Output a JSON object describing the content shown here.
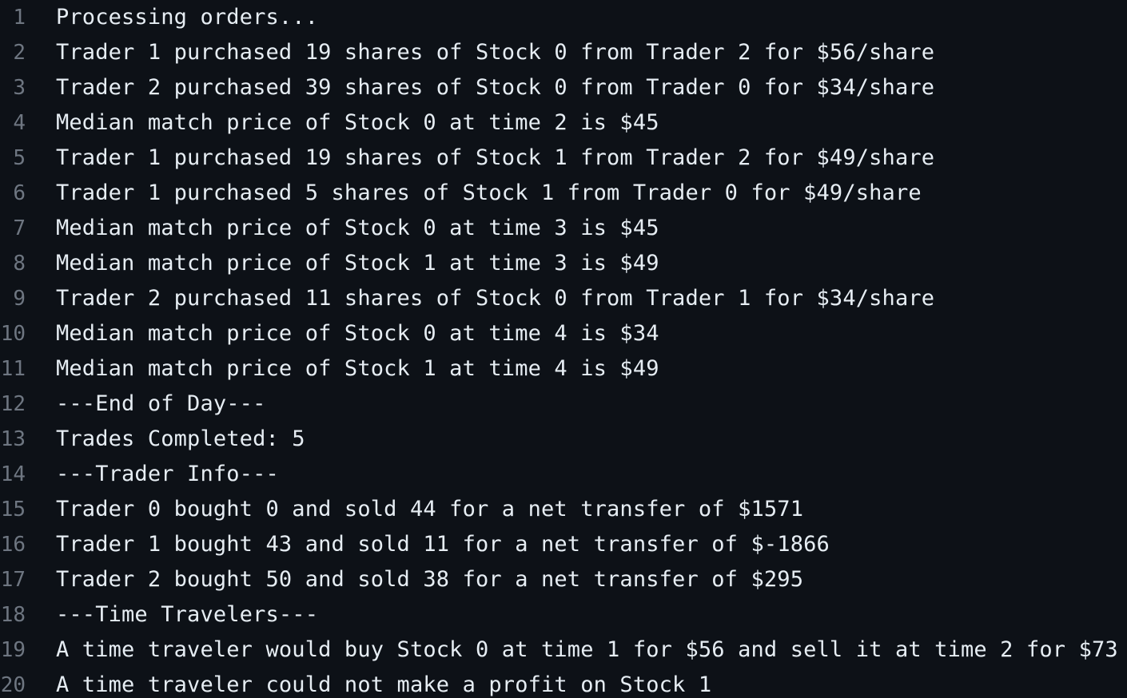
{
  "theme": {
    "background": "#0d1117",
    "text": "#e6edf3",
    "line_number": "#6e7681"
  },
  "lines": [
    {
      "n": "1",
      "text": "Processing orders..."
    },
    {
      "n": "2",
      "text": "Trader 1 purchased 19 shares of Stock 0 from Trader 2 for $56/share"
    },
    {
      "n": "3",
      "text": "Trader 2 purchased 39 shares of Stock 0 from Trader 0 for $34/share"
    },
    {
      "n": "4",
      "text": "Median match price of Stock 0 at time 2 is $45"
    },
    {
      "n": "5",
      "text": "Trader 1 purchased 19 shares of Stock 1 from Trader 2 for $49/share"
    },
    {
      "n": "6",
      "text": "Trader 1 purchased 5 shares of Stock 1 from Trader 0 for $49/share"
    },
    {
      "n": "7",
      "text": "Median match price of Stock 0 at time 3 is $45"
    },
    {
      "n": "8",
      "text": "Median match price of Stock 1 at time 3 is $49"
    },
    {
      "n": "9",
      "text": "Trader 2 purchased 11 shares of Stock 0 from Trader 1 for $34/share"
    },
    {
      "n": "10",
      "text": "Median match price of Stock 0 at time 4 is $34"
    },
    {
      "n": "11",
      "text": "Median match price of Stock 1 at time 4 is $49"
    },
    {
      "n": "12",
      "text": "---End of Day---"
    },
    {
      "n": "13",
      "text": "Trades Completed: 5"
    },
    {
      "n": "14",
      "text": "---Trader Info---"
    },
    {
      "n": "15",
      "text": "Trader 0 bought 0 and sold 44 for a net transfer of $1571"
    },
    {
      "n": "16",
      "text": "Trader 1 bought 43 and sold 11 for a net transfer of $-1866"
    },
    {
      "n": "17",
      "text": "Trader 2 bought 50 and sold 38 for a net transfer of $295"
    },
    {
      "n": "18",
      "text": "---Time Travelers---"
    },
    {
      "n": "19",
      "text": "A time traveler would buy Stock 0 at time 1 for $56 and sell it at time 2 for $73"
    },
    {
      "n": "20",
      "text": "A time traveler could not make a profit on Stock 1"
    }
  ]
}
